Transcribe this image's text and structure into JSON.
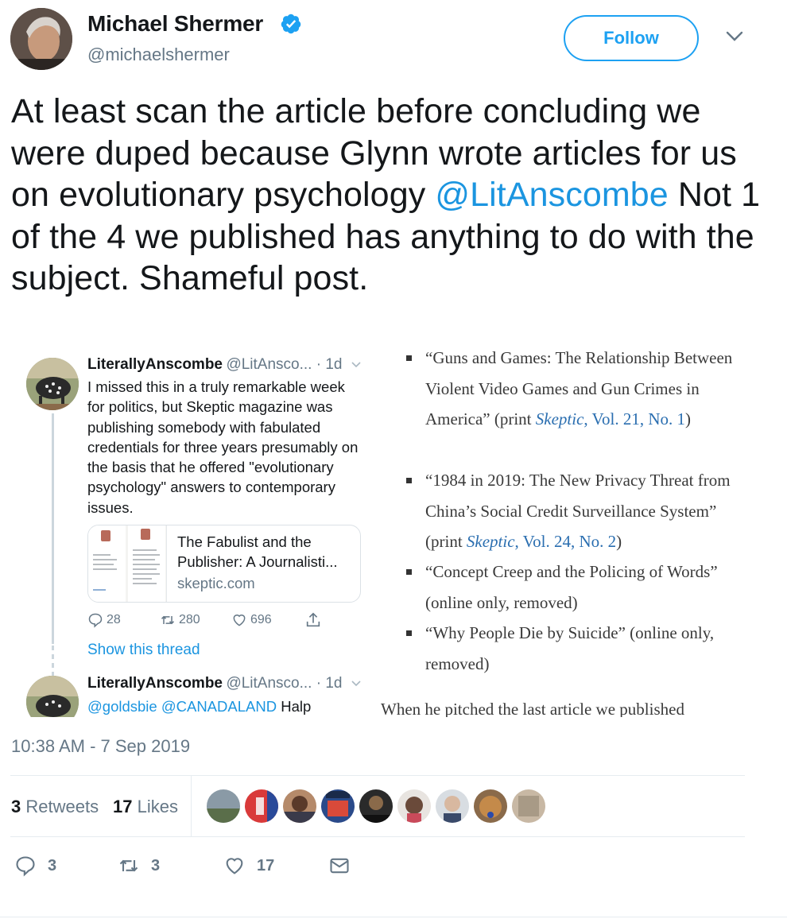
{
  "tweet": {
    "author_name": "Michael Shermer",
    "author_handle": "@michaelshermer",
    "follow_label": "Follow",
    "text_part1": "At least scan the article before concluding we were duped because Glynn wrote articles for us on evolutionary psychology ",
    "mention": "@LitAnscombe",
    "text_part2": " Not 1 of the 4 we published has anything to do with the subject. Shameful post.",
    "timestamp": "10:38 AM - 7 Sep 2019"
  },
  "embedded_thread": {
    "tweet1": {
      "name": "LiterallyAnscombe",
      "handle_time": "@LitAnsco... · 1d",
      "text": "I missed this in a truly remarkable week for politics, but Skeptic magazine was publishing somebody with fabulated credentials for three years presumably on the basis that he offered \"evolutionary psychology\" answers to contemporary issues.",
      "card_title": "The Fabulist and the Publisher: A Journalisti...",
      "card_domain": "skeptic.com",
      "replies": "28",
      "retweets": "280",
      "likes": "696"
    },
    "show_thread": "Show this thread",
    "tweet2": {
      "name": "LiterallyAnscombe",
      "handle_time": "@LitAnsco... · 1d",
      "mention1": "@goldsbie",
      "mention2": "@CANADALAND",
      "text": " Halp"
    }
  },
  "article": {
    "items": [
      {
        "text": "“Guns and Games: The Relationship Between Violent Video Games and Gun Crimes in America” (print ",
        "skeptic": "Skeptic",
        "ref": ", Vol. 21, No. 1",
        "close": ")"
      },
      {
        "text": "“1984 in 2019: The New Privacy Threat from China’s Social Credit Surveillance System” (print ",
        "skeptic": "Skeptic",
        "ref": ", Vol. 24, No. 2",
        "close": ")"
      },
      {
        "text": "“Concept Creep and the Policing of Words” (online only, removed)"
      },
      {
        "text": "“Why People Die by Suicide” (online only, removed)"
      }
    ],
    "tail": "When he pitched the last article we published"
  },
  "stats": {
    "retweets_count": "3",
    "retweets_label": "Retweets",
    "likes_count": "17",
    "likes_label": "Likes"
  },
  "actions": {
    "reply_count": "3",
    "retweet_count": "3",
    "like_count": "17"
  },
  "colors": {
    "accent": "#1da1f2",
    "link": "#1b95e0",
    "muted": "#657786"
  }
}
